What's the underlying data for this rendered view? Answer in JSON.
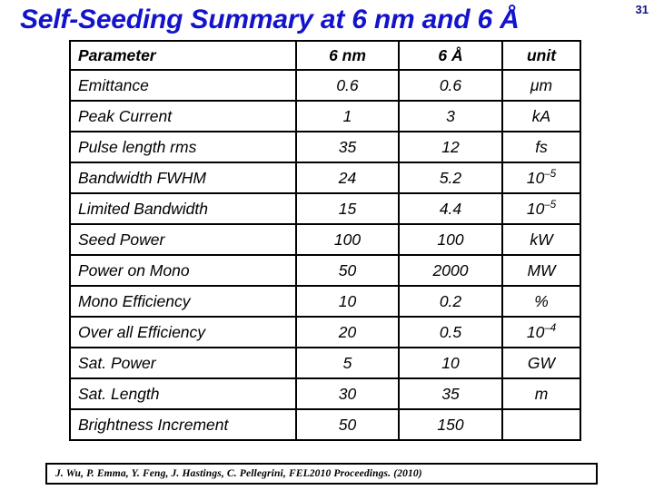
{
  "slide": {
    "title": "Self-Seeding Summary at 6 nm and 6 Å",
    "page_number": "31",
    "title_color": "#1313cc",
    "page_number_color": "#151585"
  },
  "table": {
    "columns": [
      {
        "key": "parameter",
        "label": "Parameter",
        "color": "#000000"
      },
      {
        "key": "nm",
        "label": "6 nm",
        "color": "#b01c2e"
      },
      {
        "key": "angstrom",
        "label": "6 Å",
        "color": "#1313cc"
      },
      {
        "key": "unit",
        "label": "unit",
        "color": "#000000"
      }
    ],
    "rows": [
      {
        "parameter": "Emittance",
        "nm": "0.6",
        "angstrom": "0.6",
        "unit": "μm",
        "unit_base": "",
        "unit_exp": ""
      },
      {
        "parameter": "Peak Current",
        "nm": "1",
        "angstrom": "3",
        "unit": "kA",
        "unit_base": "",
        "unit_exp": ""
      },
      {
        "parameter": "Pulse length rms",
        "nm": "35",
        "angstrom": "12",
        "unit": "fs",
        "unit_base": "",
        "unit_exp": ""
      },
      {
        "parameter": "Bandwidth FWHM",
        "nm": "24",
        "angstrom": "5.2",
        "unit": "",
        "unit_base": "10",
        "unit_exp": "–5"
      },
      {
        "parameter": "Limited Bandwidth",
        "nm": "15",
        "angstrom": "4.4",
        "unit": "",
        "unit_base": "10",
        "unit_exp": "–5"
      },
      {
        "parameter": "Seed Power",
        "nm": "100",
        "angstrom": "100",
        "unit": "kW",
        "unit_base": "",
        "unit_exp": ""
      },
      {
        "parameter": "Power on Mono",
        "nm": "50",
        "angstrom": "2000",
        "unit": "MW",
        "unit_base": "",
        "unit_exp": ""
      },
      {
        "parameter": "Mono Efficiency",
        "nm": "10",
        "angstrom": "0.2",
        "unit": "%",
        "unit_base": "",
        "unit_exp": ""
      },
      {
        "parameter": "Over all Efficiency",
        "nm": "20",
        "angstrom": "0.5",
        "unit": "",
        "unit_base": "10",
        "unit_exp": "–4"
      },
      {
        "parameter": "Sat. Power",
        "nm": "5",
        "angstrom": "10",
        "unit": "GW",
        "unit_base": "",
        "unit_exp": ""
      },
      {
        "parameter": "Sat. Length",
        "nm": "30",
        "angstrom": "35",
        "unit": "m",
        "unit_base": "",
        "unit_exp": ""
      },
      {
        "parameter": "Brightness Increment",
        "nm": "50",
        "angstrom": "150",
        "unit": "",
        "unit_base": "",
        "unit_exp": ""
      }
    ],
    "value_colors": {
      "nm": "#9e1b30",
      "angstrom": "#1a1a8c",
      "unit": "#000000",
      "parameter": "#000000"
    }
  },
  "citation": {
    "text": "J. Wu, P. Emma, Y. Feng, J. Hastings, C. Pellegrini, FEL2010 Proceedings. (2010)"
  }
}
